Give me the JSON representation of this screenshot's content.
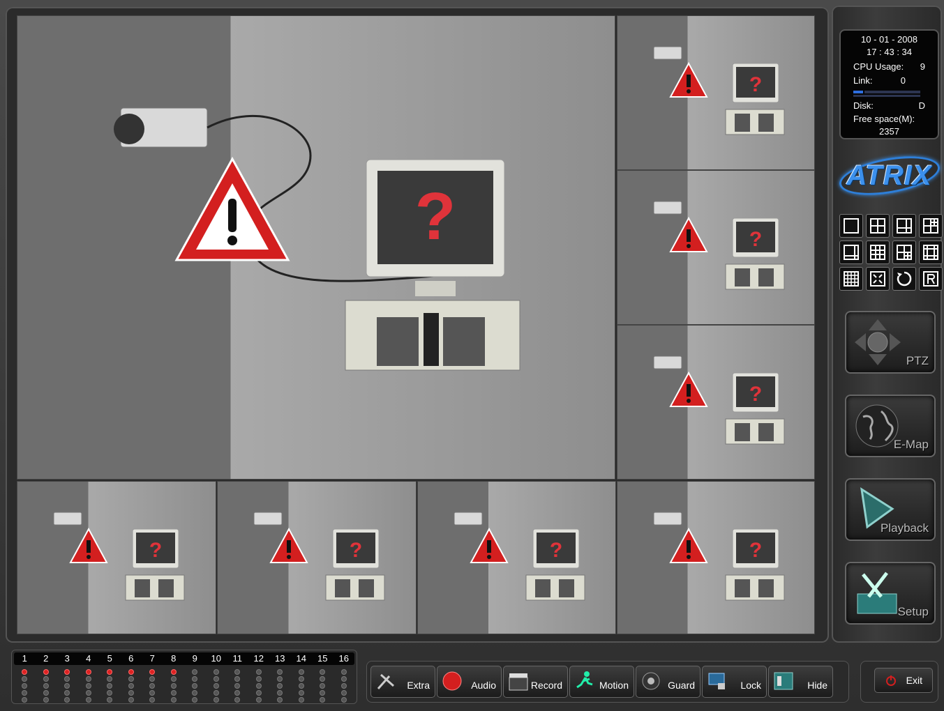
{
  "status": {
    "date": "10 - 01 - 2008",
    "time": "17 : 43 : 34",
    "cpu_label": "CPU Usage:",
    "cpu_value": "9",
    "link_label": "Link:",
    "link_value": "0",
    "disk_label": "Disk:",
    "disk_value": "D",
    "free_label": "Free space(M):",
    "free_value": "2357"
  },
  "brand": {
    "name": "ATRIX"
  },
  "layout_buttons": [
    "single-view",
    "quad-view",
    "six-view",
    "seven-view",
    "eight-view",
    "nine-view",
    "ten-view",
    "thirteen-view",
    "sixteen-view",
    "fullscreen",
    "sequence-rotate",
    "restore"
  ],
  "side_buttons": {
    "ptz": "PTZ",
    "emap": "E-Map",
    "playback": "Playback",
    "setup": "Setup"
  },
  "channels": {
    "numbers": [
      "1",
      "2",
      "3",
      "4",
      "5",
      "6",
      "7",
      "8",
      "9",
      "10",
      "11",
      "12",
      "13",
      "14",
      "15",
      "16"
    ],
    "active": [
      true,
      true,
      true,
      true,
      true,
      true,
      true,
      true,
      false,
      false,
      false,
      false,
      false,
      false,
      false,
      false
    ]
  },
  "toolbar": {
    "extra": "Extra",
    "audio": "Audio",
    "record": "Record",
    "motion": "Motion",
    "guard": "Guard",
    "lock": "Lock",
    "hide": "Hide",
    "exit": "Exit"
  },
  "colors": {
    "accent_blue": "#3c90ec",
    "warning_red": "#d31f1f",
    "led_on": "#dd2222"
  }
}
